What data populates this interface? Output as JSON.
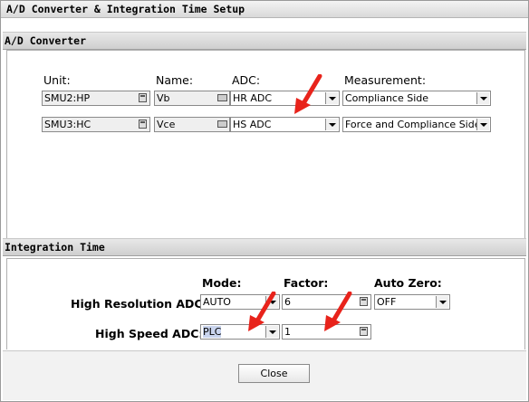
{
  "window": {
    "title": "A/D Converter & Integration Time Setup"
  },
  "ad_converter": {
    "header": "A/D Converter",
    "columns": {
      "unit": "Unit:",
      "name": "Name:",
      "adc": "ADC:",
      "measurement": "Measurement:"
    },
    "rows": [
      {
        "unit": "SMU2:HP",
        "name": "Vb",
        "adc": "HR ADC",
        "measurement": "Compliance Side"
      },
      {
        "unit": "SMU3:HC",
        "name": "Vce",
        "adc": "HS ADC",
        "measurement": "Force and Compliance Sides"
      }
    ]
  },
  "integration_time": {
    "header": "Integration Time",
    "columns": {
      "mode": "Mode:",
      "factor": "Factor:",
      "auto_zero": "Auto Zero:"
    },
    "high_resolution": {
      "label": "High Resolution ADC:",
      "mode": "AUTO",
      "factor": "6",
      "auto_zero": "OFF"
    },
    "high_speed": {
      "label": "High Speed ADC:",
      "mode": "PLC",
      "factor": "1"
    }
  },
  "buttons": {
    "close": "Close"
  },
  "colors": {
    "annotation_arrow": "#e8231b",
    "selection": "#c9d4ee"
  },
  "icons": [
    "calculator-icon",
    "keyboard-icon",
    "dropdown-arrow-icon",
    "red-annotation-arrow-icon"
  ]
}
